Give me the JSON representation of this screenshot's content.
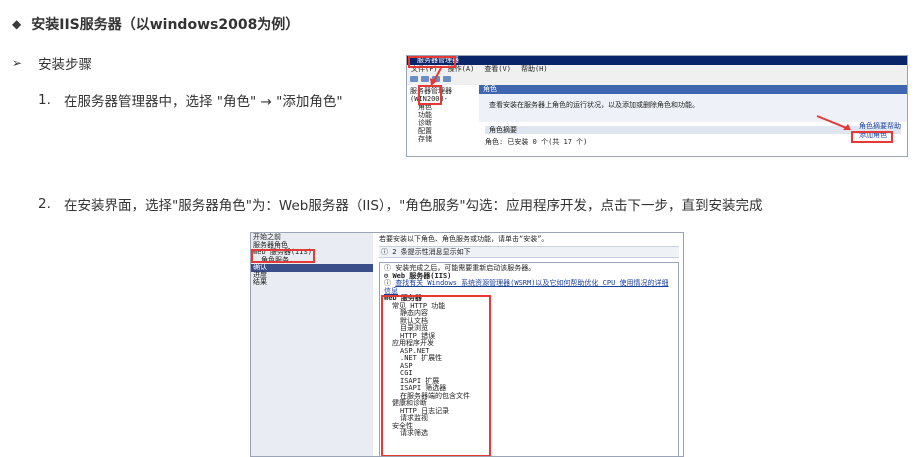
{
  "title": {
    "bullet": "◆",
    "text": "安装IIS服务器（以windows2008为例）"
  },
  "section": {
    "bullet": "➢",
    "text": "安装步骤"
  },
  "steps": [
    {
      "num": "1.",
      "text": "在服务器管理器中，选择 \"角色\" → \"添加角色\""
    },
    {
      "num": "2.",
      "text": "在安装界面，选择\"服务器角色\"为：Web服务器（IIS），\"角色服务\"勾选：应用程序开发，点击下一步，直到安装完成"
    }
  ],
  "screenshot1": {
    "window_title": "服务器管理器",
    "menu": [
      "文件(F)",
      "操作(A)",
      "查看(V)",
      "帮助(H)"
    ],
    "tree": [
      "服务器管理器 (WIN2008-",
      "角色",
      "功能",
      "诊断",
      "配置",
      "存储"
    ],
    "panel_title": "角色",
    "description": "查看安装在服务器上角色的运行状况，以及添加或删除角色和功能。",
    "summary": "角色摘要",
    "roles_count": "角色: 已安装 0 个(共 17 个)",
    "links": [
      "角色摘要帮助",
      "添加角色"
    ]
  },
  "screenshot2": {
    "nav": [
      "开始之前",
      "服务器角色",
      "Web 服务器(IIS)",
      "角色服务",
      "确认",
      "进度",
      "结果"
    ],
    "header": "若要安装以下角色、角色服务或功能，请单击“安装”。",
    "info": "2 条提示性消息显示如下",
    "restart_note": "安装完成之后，可能需要重新启动该服务器。",
    "section": "Web 服务器(IIS)",
    "link": "查找有关 Windows 系统资源管理器(WSRM)以及它如何帮助优化 CPU 使用情况的详细信息",
    "tree": [
      "Web 服务器",
      "常见 HTTP 功能",
      "静态内容",
      "默认文档",
      "目录浏览",
      "HTTP 错误",
      "应用程序开发",
      "ASP.NET",
      ".NET 扩展性",
      "ASP",
      "CGI",
      "ISAPI 扩展",
      "ISAPI 筛选器",
      "在服务器端的包含文件",
      "健康和诊断",
      "HTTP 日志记录",
      "请求监视",
      "安全性",
      "请求筛选"
    ]
  },
  "colors": {
    "highlight": "#e53935",
    "text": "#333333"
  }
}
